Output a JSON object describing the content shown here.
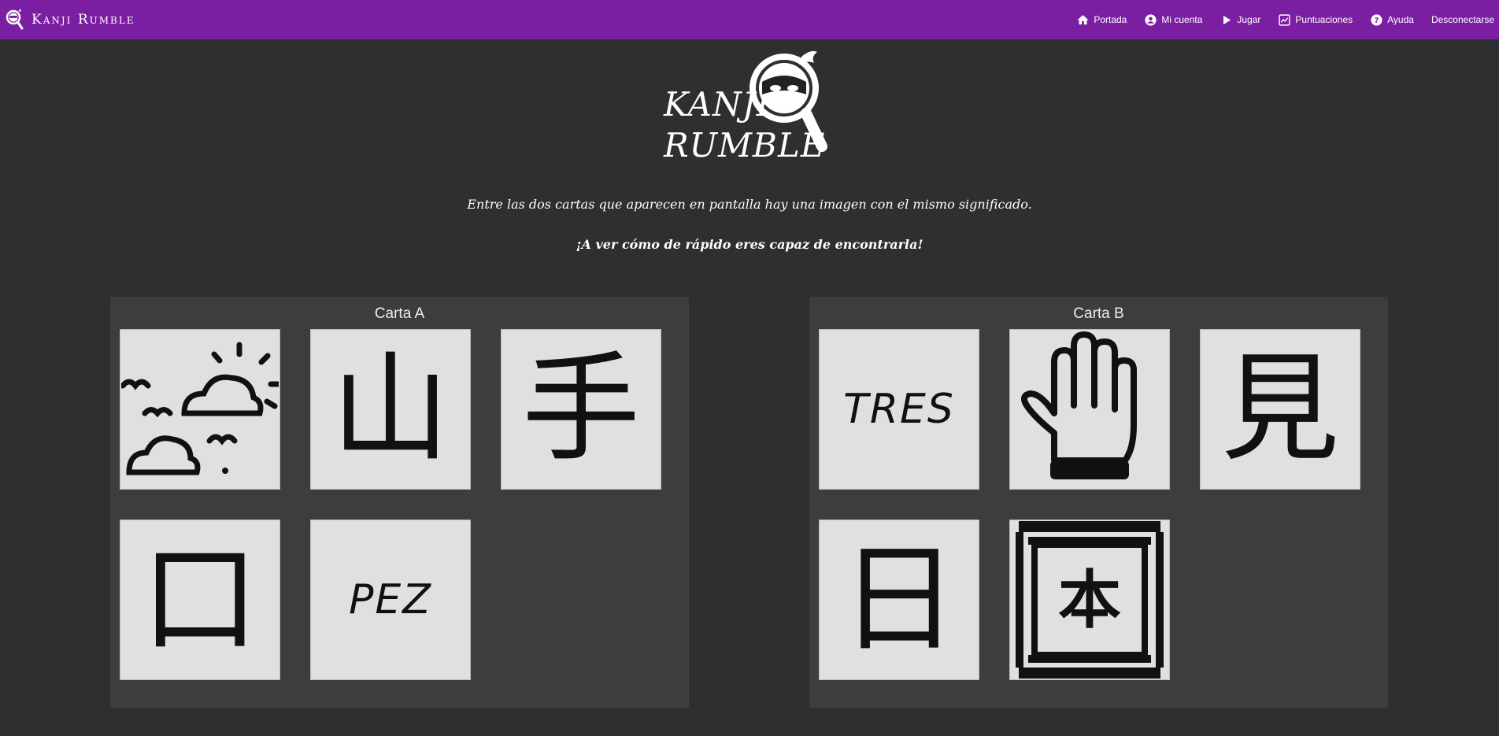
{
  "app": {
    "title": "Kanji Rumble"
  },
  "nav": {
    "items": [
      {
        "label": "Portada",
        "icon": "home-icon"
      },
      {
        "label": "Mi cuenta",
        "icon": "account-icon"
      },
      {
        "label": "Jugar",
        "icon": "play-icon"
      },
      {
        "label": "Puntuaciones",
        "icon": "scores-icon"
      },
      {
        "label": "Ayuda",
        "icon": "help-icon"
      },
      {
        "label": "Desconectarse",
        "icon": ""
      }
    ]
  },
  "hero": {
    "logo_line1": "KANJI",
    "logo_line2": "RUMBLE",
    "description": "Entre las dos cartas que aparecen en pantalla hay una imagen con el mismo significado.",
    "challenge": "¡A ver cómo de rápido eres capaz de encontrarla!"
  },
  "cards": {
    "a": {
      "title": "Carta A",
      "items": [
        {
          "type": "image",
          "icon": "sky-weather-icon"
        },
        {
          "type": "kanji",
          "text": "山"
        },
        {
          "type": "kanji",
          "text": "手"
        },
        {
          "type": "kanji",
          "text": "口"
        },
        {
          "type": "word",
          "text": "PEZ"
        }
      ]
    },
    "b": {
      "title": "Carta B",
      "items": [
        {
          "type": "word",
          "text": "TRES"
        },
        {
          "type": "image",
          "icon": "hand-icon"
        },
        {
          "type": "kanji",
          "text": "見"
        },
        {
          "type": "kanji",
          "text": "日"
        },
        {
          "type": "image",
          "icon": "book-scroll-icon",
          "text": "本"
        }
      ]
    }
  },
  "colors": {
    "navbar": "#7b1fa2",
    "background": "#2f2f2f",
    "panel": "#3d3d3d",
    "card": "#e0e0e0"
  }
}
